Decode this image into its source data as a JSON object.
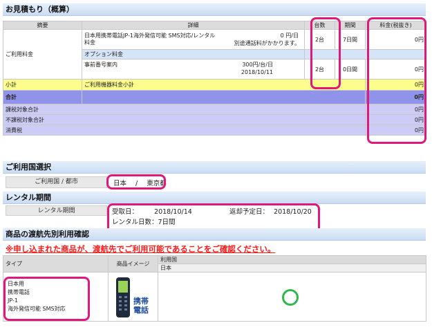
{
  "estimate": {
    "section_title": "お見積もり（概算）",
    "headers": {
      "summary": "摘要",
      "detail": "詳細",
      "units": "台数",
      "period": "期間",
      "fee": "料金(税抜き)"
    },
    "usage_fee_label": "ご利用料金",
    "item1": {
      "name": "日本用携帯電話JP-1海外発信可能 SMS対応/レンタル料金",
      "price": "0 円/日",
      "note": "別途通話料がかかります。",
      "units": "2台",
      "period": "7日間",
      "fee": "0円"
    },
    "option_label": "オプション料金",
    "item2": {
      "name": "事前番号案内",
      "price": "300円/台/日",
      "date": "2018/10/11",
      "units": "2台",
      "period": "0日間",
      "fee": "0円"
    },
    "subtotal": {
      "label": "小計",
      "desc": "ご利用機器料金小計",
      "fee": "0円"
    },
    "total": {
      "label": "合計",
      "fee": "0円"
    },
    "tax_rows": [
      {
        "label": "課税対象合計",
        "fee": "0円"
      },
      {
        "label": "不課税対象合計",
        "fee": "0円"
      },
      {
        "label": "消費税",
        "fee": "0円"
      }
    ]
  },
  "country": {
    "section_title": "ご利用国選択",
    "label": "ご利用国 / 都市",
    "country": "日本",
    "separator": "/",
    "city": "東京都"
  },
  "rental": {
    "section_title": "レンタル期間",
    "label": "レンタル期間",
    "pickup_label": "受取日：",
    "pickup_date": "2018/10/14",
    "return_label": "返却予定日：",
    "return_date": "2018/10/20",
    "days": "レンタル日数：7日間"
  },
  "destination": {
    "section_title": "商品の渡航先別利用確認",
    "warning": "※申し込まれた商品が、渡航先でご利用可能であることをご確認ください。",
    "headers": {
      "type": "タイプ",
      "image": "商品イメージ",
      "countries": "利用国",
      "japan": "日本"
    },
    "product_type": [
      "日本用",
      "携帯電話",
      "JP-1",
      "海外発信可能 SMS対応"
    ],
    "phone_caption": [
      "携帯",
      "電話"
    ]
  },
  "colors": {
    "highlight": "#e0187c",
    "subtotal": "#fdfd8e",
    "total": "#8f93e9",
    "tax": "#ccccf6",
    "available": "#2db84a"
  }
}
